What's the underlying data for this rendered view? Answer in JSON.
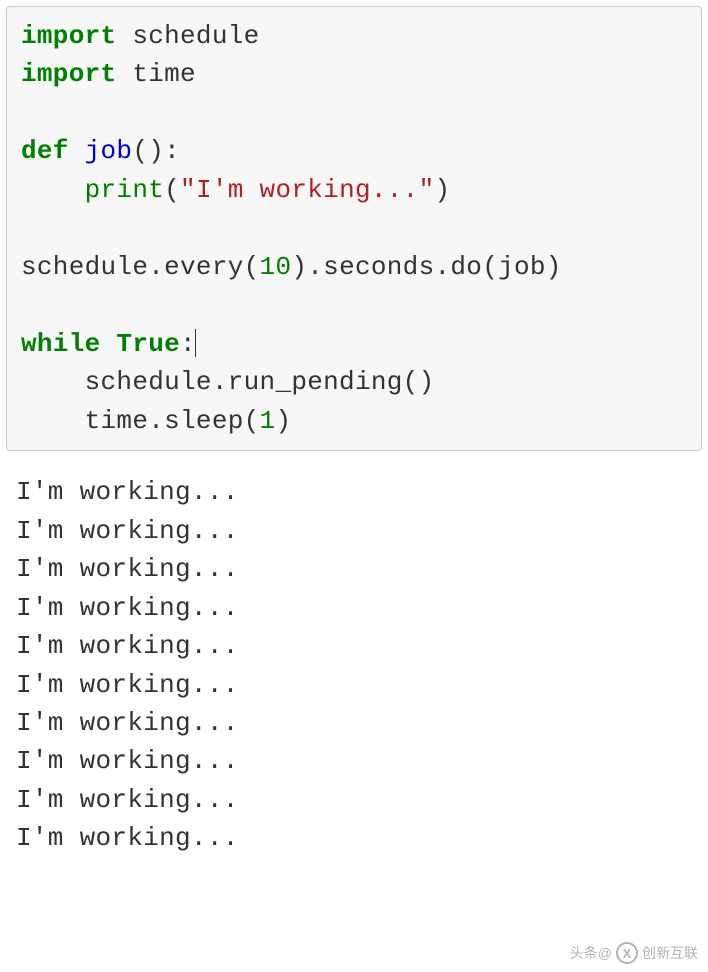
{
  "code": {
    "lines": [
      {
        "tokens": [
          {
            "t": "import",
            "c": "kw"
          },
          {
            "t": " schedule",
            "c": "plain"
          }
        ]
      },
      {
        "tokens": [
          {
            "t": "import",
            "c": "kw"
          },
          {
            "t": " time",
            "c": "plain"
          }
        ]
      },
      {
        "tokens": [
          {
            "t": "",
            "c": "plain"
          }
        ]
      },
      {
        "tokens": [
          {
            "t": "def",
            "c": "kw"
          },
          {
            "t": " ",
            "c": "plain"
          },
          {
            "t": "job",
            "c": "fn"
          },
          {
            "t": "():",
            "c": "plain"
          }
        ]
      },
      {
        "tokens": [
          {
            "t": "    ",
            "c": "plain"
          },
          {
            "t": "print",
            "c": "nb"
          },
          {
            "t": "(",
            "c": "plain"
          },
          {
            "t": "\"I'm working...\"",
            "c": "str"
          },
          {
            "t": ")",
            "c": "plain"
          }
        ]
      },
      {
        "tokens": [
          {
            "t": "",
            "c": "plain"
          }
        ]
      },
      {
        "tokens": [
          {
            "t": "schedule.every(",
            "c": "plain"
          },
          {
            "t": "10",
            "c": "num"
          },
          {
            "t": ").seconds.do(job)",
            "c": "plain"
          }
        ]
      },
      {
        "tokens": [
          {
            "t": "",
            "c": "plain"
          }
        ]
      },
      {
        "tokens": [
          {
            "t": "while",
            "c": "kw"
          },
          {
            "t": " ",
            "c": "plain"
          },
          {
            "t": "True",
            "c": "kw"
          },
          {
            "t": ":",
            "c": "plain"
          }
        ],
        "cursor": true
      },
      {
        "tokens": [
          {
            "t": "    schedule.run_pending()",
            "c": "plain"
          }
        ]
      },
      {
        "tokens": [
          {
            "t": "    time.sleep(",
            "c": "plain"
          },
          {
            "t": "1",
            "c": "num"
          },
          {
            "t": ")",
            "c": "plain"
          }
        ]
      }
    ]
  },
  "output": {
    "lines": [
      "I'm working...",
      "I'm working...",
      "I'm working...",
      "I'm working...",
      "I'm working...",
      "I'm working...",
      "I'm working...",
      "I'm working...",
      "I'm working...",
      "I'm working..."
    ]
  },
  "watermark": {
    "prefix": "头条@",
    "brand": "创新互联",
    "logo": "X"
  }
}
